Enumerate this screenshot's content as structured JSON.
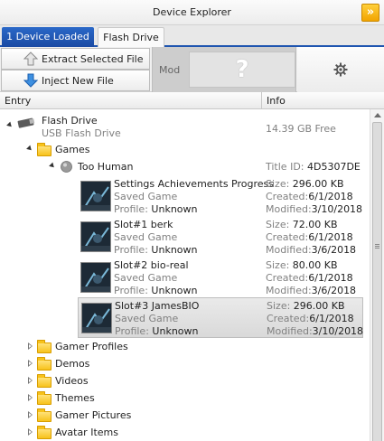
{
  "window": {
    "title": "Device Explorer",
    "collapse_glyph": "»"
  },
  "tabs": [
    {
      "label": "1 Device Loaded",
      "active": true
    },
    {
      "label": "Flash Drive",
      "active": false
    }
  ],
  "toolbar": {
    "extract_label": "Extract Selected File",
    "inject_label": "Inject New File",
    "mod_label": "Mod",
    "mod_placeholder": "?",
    "settings_icon": "gear-icon"
  },
  "columns": {
    "entry": "Entry",
    "info": "Info"
  },
  "tree": {
    "device": {
      "name": "Flash Drive",
      "subtitle": "USB Flash Drive",
      "info": "14.39 GB Free"
    },
    "games_folder": "Games",
    "game": {
      "name": "Too Human",
      "info": "Title ID: 4D5307DE"
    },
    "items": [
      {
        "name": "Settings  Achievements Progress",
        "type": "Saved Game",
        "profile_label": "Profile:",
        "profile": "Unknown",
        "size_label": "Size:",
        "size": "296.00 KB",
        "created_label": "Created:",
        "created": "6/1/2018",
        "modified_label": "Modified:",
        "modified": "3/10/2018",
        "selected": false
      },
      {
        "name": "Slot#1 berk",
        "type": "Saved Game",
        "profile_label": "Profile:",
        "profile": "Unknown",
        "size_label": "Size:",
        "size": "72.00 KB",
        "created_label": "Created:",
        "created": "6/1/2018",
        "modified_label": "Modified:",
        "modified": "3/6/2018",
        "selected": false
      },
      {
        "name": "Slot#2 bio-real",
        "type": "Saved Game",
        "profile_label": "Profile:",
        "profile": "Unknown",
        "size_label": "Size:",
        "size": "80.00 KB",
        "created_label": "Created:",
        "created": "6/1/2018",
        "modified_label": "Modified:",
        "modified": "3/6/2018",
        "selected": false
      },
      {
        "name": "Slot#3 JamesBIO",
        "type": "Saved Game",
        "profile_label": "Profile:",
        "profile": "Unknown",
        "size_label": "Size:",
        "size": "296.00 KB",
        "created_label": "Created:",
        "created": "6/1/2018",
        "modified_label": "Modified:",
        "modified": "3/10/2018",
        "selected": true
      }
    ],
    "folders": [
      "Gamer Profiles",
      "Demos",
      "Videos",
      "Themes",
      "Gamer Pictures",
      "Avatar Items"
    ]
  },
  "colors": {
    "accent": "#1f55b0",
    "collapse_button": "#f2a400",
    "folder": "#f7c21b"
  }
}
